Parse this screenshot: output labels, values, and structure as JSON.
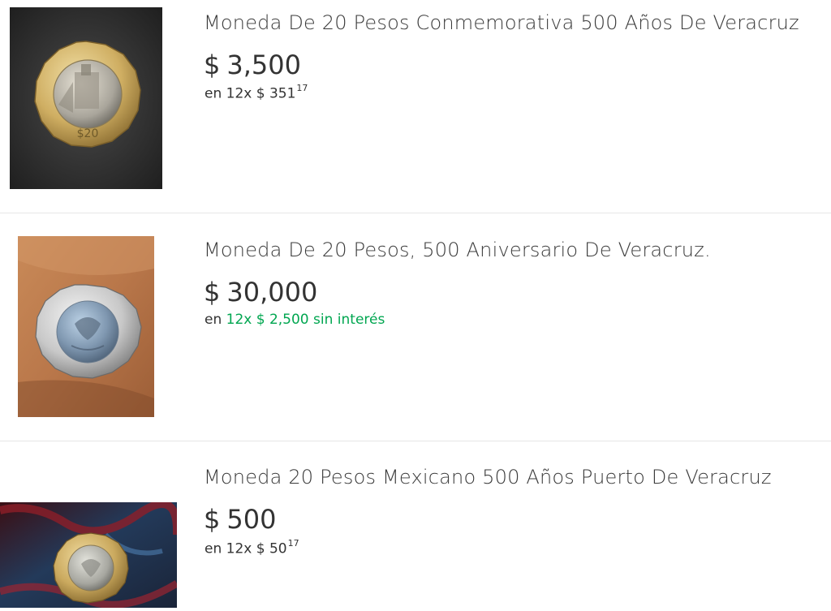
{
  "listings": [
    {
      "title": "Moneda De 20 Pesos Conmemorativa 500 Años De Veracruz",
      "currency": "$",
      "price": "3,500",
      "installments_prefix": "en 12x $ 351",
      "installments_cents": "17",
      "image_icon": "coin-veracruz-obverse-photo"
    },
    {
      "title": "Moneda De 20 Pesos, 500 Aniversario De Veracruz.",
      "currency": "$",
      "price": "30,000",
      "installments_prefix": "en",
      "installments_highlight": "12x $ 2,500 sin interés",
      "image_icon": "coin-mexican-eagle-photo"
    },
    {
      "title": "Moneda 20 Pesos Mexicano 500 Años Puerto De Veracruz",
      "currency": "$",
      "price": "500",
      "installments_prefix": "en 12x $ 50",
      "installments_cents": "17",
      "image_icon": "coin-on-fabric-photo"
    }
  ],
  "colors": {
    "installment_green": "#00a650",
    "text": "#333333",
    "divider": "#e6e6e6"
  }
}
